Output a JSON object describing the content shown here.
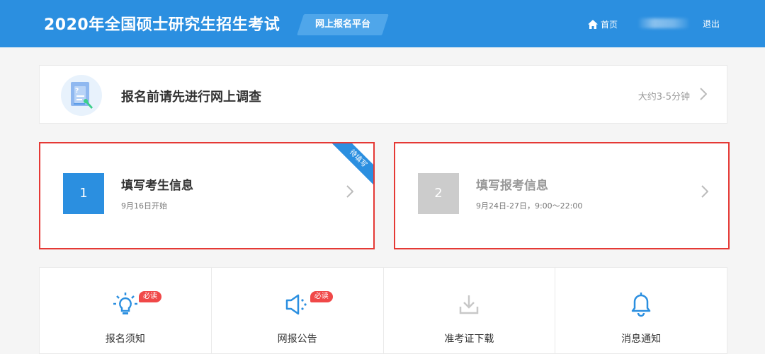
{
  "header": {
    "site_title": "2020年全国硕士研究生招生考试",
    "platform_tag": "网上报名平台",
    "home_label": "首页",
    "logout_label": "退出"
  },
  "survey": {
    "title": "报名前请先进行网上调查",
    "time_hint": "大约3-5分钟",
    "icon": "questionnaire-icon"
  },
  "steps": [
    {
      "number": "1",
      "title": "填写考生信息",
      "subtitle": "9月16日开始",
      "ribbon": "待填写",
      "color": "#2b8fe0",
      "title_color": "#333333",
      "status": "active"
    },
    {
      "number": "2",
      "title": "填写报考信息",
      "subtitle": "9月24日-27日，9:00～22:00",
      "color": "#cccccc",
      "title_color": "#999999",
      "status": "disabled"
    }
  ],
  "tiles": [
    {
      "label": "报名须知",
      "badge": "必读",
      "icon": "lightbulb-icon"
    },
    {
      "label": "网报公告",
      "badge": "必读",
      "icon": "megaphone-icon"
    },
    {
      "label": "准考证下载",
      "icon": "download-icon"
    },
    {
      "label": "消息通知",
      "icon": "bell-icon"
    }
  ],
  "colors": {
    "primary": "#2b8fe0",
    "alert_border": "#e53935",
    "badge": "#f04848",
    "disabled": "#cccccc"
  }
}
